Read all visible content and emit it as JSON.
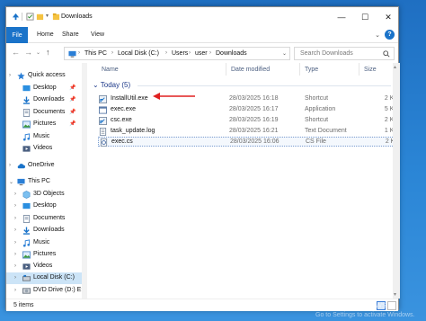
{
  "window": {
    "title": "Downloads",
    "controls": {
      "minimize": "—",
      "maximize": "☐",
      "close": "✕"
    }
  },
  "ribbon": {
    "tabs": [
      "File",
      "Home",
      "Share",
      "View"
    ],
    "help": "?"
  },
  "address": {
    "crumbs": [
      "This PC",
      "Local Disk (C:)",
      "Users",
      "user",
      "Downloads"
    ],
    "search_placeholder": "Search Downloads"
  },
  "nav": {
    "quick_access": "Quick access",
    "quick_items": [
      "Desktop",
      "Downloads",
      "Documents",
      "Pictures",
      "Music",
      "Videos"
    ],
    "onedrive": "OneDrive",
    "this_pc": "This PC",
    "pc_items": [
      "3D Objects",
      "Desktop",
      "Documents",
      "Downloads",
      "Music",
      "Pictures",
      "Videos",
      "Local Disk (C:)",
      "DVD Drive (D:) E:"
    ]
  },
  "columns": {
    "name": "Name",
    "date": "Date modified",
    "type": "Type",
    "size": "Size"
  },
  "group": {
    "label": "Today (5)"
  },
  "files": [
    {
      "name": "InstallUtil.exe",
      "date": "28/03/2025 16:18",
      "type": "Shortcut",
      "size": "2 KB",
      "icon": "shortcut-icon"
    },
    {
      "name": "exec.exe",
      "date": "28/03/2025 16:17",
      "type": "Application",
      "size": "5 KB",
      "icon": "exe-icon"
    },
    {
      "name": "csc.exe",
      "date": "28/03/2025 16:19",
      "type": "Shortcut",
      "size": "2 KB",
      "icon": "shortcut-icon"
    },
    {
      "name": "task_update.log",
      "date": "28/03/2025 16:21",
      "type": "Text Document",
      "size": "1 KB",
      "icon": "text-file-icon"
    },
    {
      "name": "exec.cs",
      "date": "28/03/2025 16:06",
      "type": "CS File",
      "size": "2 KB",
      "icon": "cs-file-icon"
    }
  ],
  "status": {
    "items": "5 items"
  },
  "watermark": {
    "line1": "Activate Windows",
    "line2": "Go to Settings to activate Windows."
  },
  "colors": {
    "accent": "#1a73c9",
    "annotation": "#e02020",
    "folder": "#f5c342"
  }
}
